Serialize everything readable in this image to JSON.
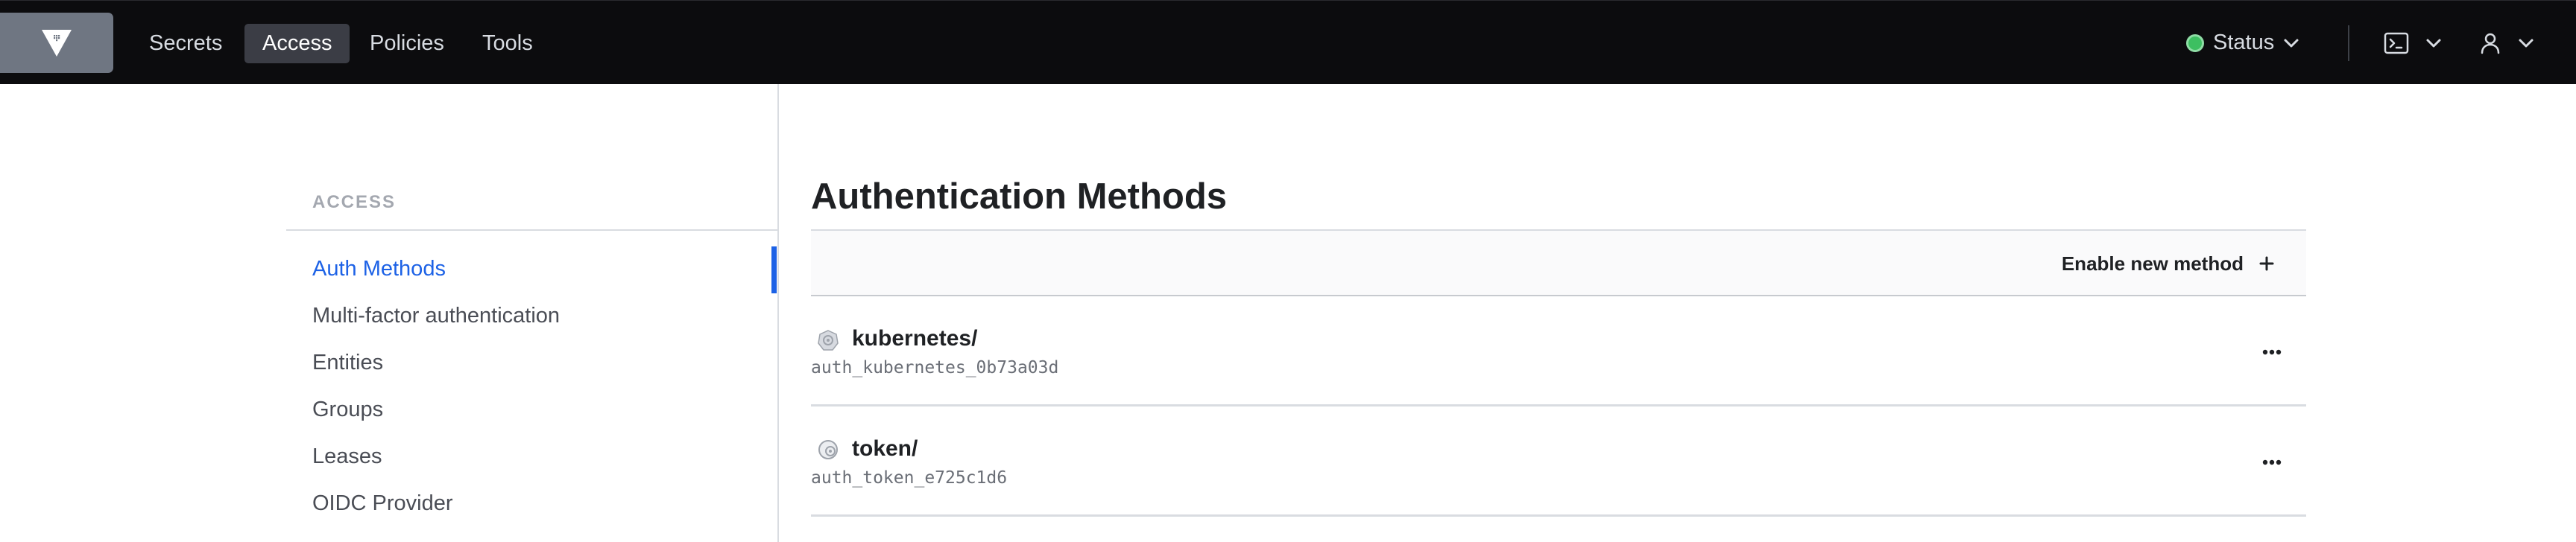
{
  "app": {
    "brand_logo": "vault-logo"
  },
  "nav": {
    "items": [
      {
        "label": "Secrets"
      },
      {
        "label": "Access",
        "active": true
      },
      {
        "label": "Policies"
      },
      {
        "label": "Tools"
      }
    ],
    "status_label": "Status",
    "status_color": "#3dbf61"
  },
  "sidebar": {
    "heading": "ACCESS",
    "items": [
      {
        "label": "Auth Methods",
        "active": true
      },
      {
        "label": "Multi-factor authentication"
      },
      {
        "label": "Entities"
      },
      {
        "label": "Groups"
      },
      {
        "label": "Leases"
      },
      {
        "label": "OIDC Provider"
      }
    ],
    "accent_color": "#1d62e6"
  },
  "main": {
    "title": "Authentication Methods",
    "enable_button_label": "Enable new method",
    "methods": [
      {
        "name": "kubernetes/",
        "accessor": "auth_kubernetes_0b73a03d",
        "icon": "kubernetes-icon"
      },
      {
        "name": "token/",
        "accessor": "auth_token_e725c1d6",
        "icon": "token-icon"
      }
    ]
  }
}
